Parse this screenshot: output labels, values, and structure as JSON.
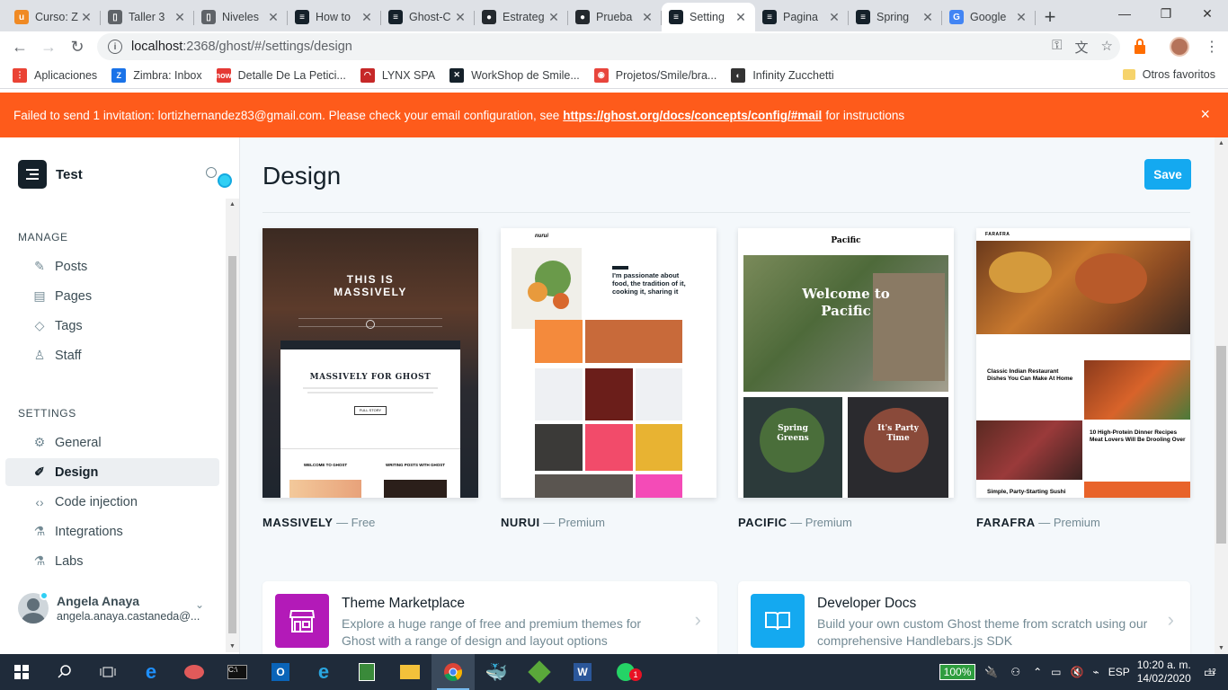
{
  "browser": {
    "tabs": [
      {
        "title": "Curso: Z",
        "color": "#f08a24",
        "glyph": "u"
      },
      {
        "title": "Taller 3",
        "color": "#5f6368",
        "glyph": "▯"
      },
      {
        "title": "Niveles",
        "color": "#5f6368",
        "glyph": "▯"
      },
      {
        "title": "How to",
        "color": "#15212a",
        "glyph": "≡"
      },
      {
        "title": "Ghost-C",
        "color": "#15212a",
        "glyph": "≡"
      },
      {
        "title": "Estrateg",
        "color": "#24292e",
        "glyph": "●"
      },
      {
        "title": "Prueba",
        "color": "#24292e",
        "glyph": "●"
      },
      {
        "title": "Setting",
        "color": "#15212a",
        "glyph": "≡",
        "active": true
      },
      {
        "title": "Pagina",
        "color": "#15212a",
        "glyph": "≡"
      },
      {
        "title": "Spring",
        "color": "#15212a",
        "glyph": "≡"
      },
      {
        "title": "Google",
        "color": "#4285f4",
        "glyph": "G"
      }
    ],
    "url_host": "localhost",
    "url_path": ":2368/ghost/#/settings/design",
    "bookmarks": [
      {
        "label": "Aplicaciones",
        "color": "#ea4335",
        "glyph": "⋮"
      },
      {
        "label": "Zimbra: Inbox",
        "color": "#1a73e8",
        "glyph": "Z"
      },
      {
        "label": "Detalle De La Petici...",
        "color": "#e53935",
        "glyph": "now"
      },
      {
        "label": "LYNX SPA",
        "color": "#c62828",
        "glyph": "◠"
      },
      {
        "label": "WorkShop de Smile...",
        "color": "#15212a",
        "glyph": "✕"
      },
      {
        "label": "Projetos/Smile/bra...",
        "color": "#e8453c",
        "glyph": "◉"
      },
      {
        "label": "Infinity Zucchetti",
        "color": "#333333",
        "glyph": "◐"
      }
    ],
    "other_bookmarks": "Otros favoritos"
  },
  "notification": {
    "before": "Failed to send 1 invitation: lortizhernandez83@gmail.com. Please check your email configuration, see",
    "link": "https://ghost.org/docs/concepts/config/#mail",
    "after": "for instructions",
    "close": "×"
  },
  "sidebar": {
    "site_name": "Test",
    "manage_heading": "MANAGE",
    "manage": [
      {
        "label": "Posts",
        "icon": "✎"
      },
      {
        "label": "Pages",
        "icon": "▤"
      },
      {
        "label": "Tags",
        "icon": "◇"
      },
      {
        "label": "Staff",
        "icon": "♙"
      }
    ],
    "settings_heading": "SETTINGS",
    "settings": [
      {
        "label": "General",
        "icon": "⚙"
      },
      {
        "label": "Design",
        "icon": "✐",
        "active": true
      },
      {
        "label": "Code injection",
        "icon": "‹›"
      },
      {
        "label": "Integrations",
        "icon": "⚗"
      },
      {
        "label": "Labs",
        "icon": "⚗"
      }
    ],
    "user_name": "Angela Anaya",
    "user_email": "angela.anaya.castaneda@..."
  },
  "main": {
    "title": "Design",
    "save_label": "Save",
    "themes": [
      {
        "name": "MASSIVELY",
        "tier": "— Free"
      },
      {
        "name": "NURUI",
        "tier": "— Premium"
      },
      {
        "name": "PACIFIC",
        "tier": "— Premium"
      },
      {
        "name": "FARAFRA",
        "tier": "— Premium"
      }
    ],
    "massively": {
      "hero": "THIS IS\nMASSIVELY",
      "headline": "MASSIVELY FOR GHOST",
      "btn": "FULL STORY",
      "a1": "WELCOME TO GHOST",
      "a2": "WRITING POSTS WITH GHOST"
    },
    "nurui": {
      "logo": "nurui",
      "headline": "I'm passionate about food, the tradition of it, cooking it, sharing it"
    },
    "pacific": {
      "logo": "Pacific",
      "hero": "Welcome to\nPacific",
      "t1": "Spring\nGreens",
      "t2": "It's Party\nTime"
    },
    "farafra": {
      "logo": "FARAFRA",
      "p1": "Classic Indian Restaurant Dishes You Can Make At Home",
      "p2": "10 High-Protein Dinner Recipes Meat Lovers Will Be Drooling Over",
      "p3": "Simple, Party-Starting Sushi"
    },
    "cards": [
      {
        "title": "Theme Marketplace",
        "desc": "Explore a huge range of free and premium themes for Ghost with a range of design and layout options",
        "color": "#b31ab8"
      },
      {
        "title": "Developer Docs",
        "desc": "Build your own custom Ghost theme from scratch using our comprehensive Handlebars.js SDK",
        "color": "#14a9f0"
      }
    ]
  },
  "taskbar": {
    "battery": "100%",
    "lang": "ESP",
    "time": "10:20 a. m.",
    "date": "14/02/2020",
    "notif_count": "12",
    "whatsapp_badge": "1"
  }
}
